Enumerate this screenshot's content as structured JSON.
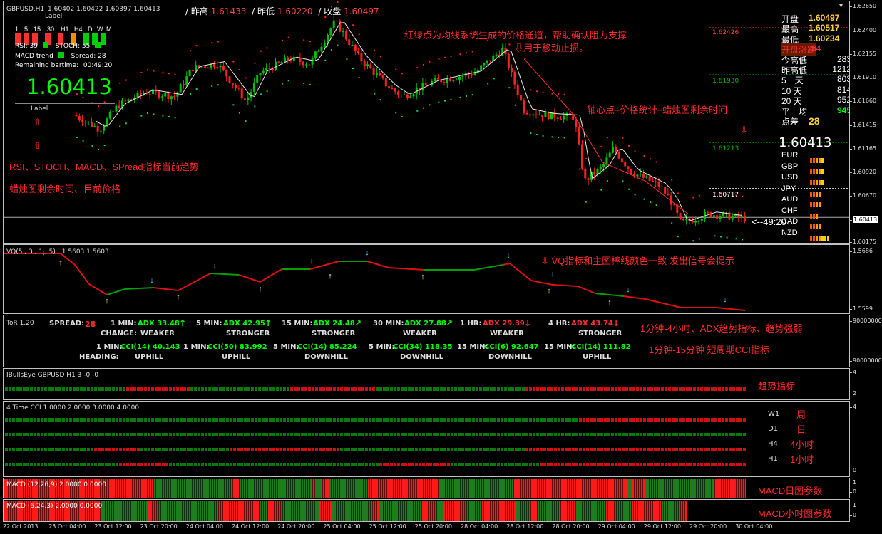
{
  "header": {
    "symbol": "GBPUSD,H1",
    "ohlc": "1.60402 1.60422 1.60397 1.60413",
    "sep": "/",
    "y_high_label": "昨高",
    "y_high": "1.61433",
    "y_low_label": "昨低",
    "y_low": "1.60220",
    "y_close_label": "收盘",
    "y_close": "1.60497"
  },
  "info": {
    "label_top": "Label",
    "timeframes": [
      "1",
      "5",
      "15",
      "30",
      "H1",
      "H4",
      "D",
      "W",
      "M"
    ],
    "tf_colors": [
      "#ff3030",
      "#ff3030",
      "#ff3030",
      "#ff3030",
      "#ff3030",
      "#ff8c00",
      "#00d000",
      "#00d000",
      "#00d000"
    ],
    "tf_colors_row2": [
      "#ff3030",
      "#ff3030",
      "#ff3030",
      "#ff3030",
      "#ff3030",
      "#ff8c00",
      "#00d000",
      "#00d000",
      "#00d000"
    ],
    "rsi": "RSI: 39",
    "stoch": "STOCH: 55",
    "macd_trend": "MACD trend",
    "spread": "Spread: 28",
    "remaining_label": "Remaining bartime:",
    "remaining": "00:49:20",
    "price": "1.60413",
    "label_bottom": "Label"
  },
  "annotations": {
    "channel_line1": "红绿点为均线系统生成的价格通道，帮助确认阻力支撑",
    "channel_line2": "⇩用于移动止损。",
    "pivot": "轴心点+价格统计+蜡烛图剩余时间",
    "arrow_down": "⇩",
    "arrow_up1": "⇧",
    "arrow_up2": "⇧",
    "indicators": "RSI、STOCH、MACD、SPread指标当前趋势",
    "candle_time": "蜡烛图剩余时间、目前价格",
    "vq": "⇩  VQ指标和主图棒线颜色一致 发出信号会提示",
    "adx": "1分钟-4小时、ADX趋势指标、趋势强弱",
    "cci": "1分钟-15分钟 短周期CCI指标",
    "trend": "趋势指标",
    "macd_d": "MACD日图参数",
    "macd_h": "MACD小时图参数"
  },
  "pivots": [
    "1.62426",
    "1.61930",
    "1.61213",
    "1.60717"
  ],
  "countdown": "<--49:20",
  "stats": [
    {
      "label": "开盘",
      "value": "1.60497",
      "color": "#ffd040"
    },
    {
      "label": "最高",
      "value": "1.60517",
      "color": "#ffd040"
    },
    {
      "label": "最低",
      "value": "1.60234",
      "color": "#ffd040"
    },
    {
      "label": "开盘涨跌",
      "value": "-84",
      "color": "#ff3030"
    },
    {
      "label": "今高低",
      "value": "283",
      "color": "#ffffff"
    },
    {
      "label": "昨高低",
      "value": "1212",
      "color": "#ffffff"
    },
    {
      "label": "5　天",
      "value": "803",
      "color": "#ffffff"
    },
    {
      "label": "10 天",
      "value": "814",
      "color": "#ffffff"
    },
    {
      "label": "20 天",
      "value": "952",
      "color": "#ffffff"
    },
    {
      "label": "平　均",
      "value": "945",
      "color": "#00ff00"
    },
    {
      "label": "点差",
      "value": "28",
      "color": "#ffd040"
    }
  ],
  "big_price": "1.60413",
  "currencies": [
    "EUR",
    "GBP",
    "USD",
    "JPY",
    "AUD",
    "CHF",
    "CAD",
    "NZD"
  ],
  "price_scale": [
    "1.62650",
    "1.62400",
    "1.62155",
    "1.61910",
    "1.61660",
    "1.61415",
    "1.61165",
    "1.60920",
    "1.60670",
    "1.60413",
    "1.60175"
  ],
  "vq": {
    "title": "VQ(5 , 3 , 1 , 5)",
    "values": "1.5603 1.5603",
    "scale": [
      "1.5686",
      "1.5599"
    ]
  },
  "tor": {
    "title": "ToR 1.20",
    "spread_label": "SPREAD:",
    "spread": "28",
    "change_label": "CHANGE:",
    "heading_label": "HEADING:",
    "adx": [
      {
        "tf": "1 MIN:",
        "val": "ADX 33.48",
        "arrow": "↑",
        "state": "WEAKER",
        "color": "#00ff00"
      },
      {
        "tf": "5 MIN:",
        "val": "ADX 42.95",
        "arrow": "↑",
        "state": "STRONGER",
        "color": "#00ff00"
      },
      {
        "tf": "15 MIN:",
        "val": "ADX 24.48",
        "arrow": "↗",
        "state": "STRONGER",
        "color": "#00ff00"
      },
      {
        "tf": "30 MIN:",
        "val": "ADX 27.88",
        "arrow": "↗",
        "state": "WEAKER",
        "color": "#00ff00"
      },
      {
        "tf": "1 HR:",
        "val": "ADX 29.39",
        "arrow": "↓",
        "state": "WEAKER",
        "color": "#ff3030"
      },
      {
        "tf": "4 HR:",
        "val": "ADX 43.74",
        "arrow": "↓",
        "state": "STRONGER",
        "color": "#ff3030"
      }
    ],
    "cci": [
      {
        "tf": "1 MIN:",
        "val": "CCI(14) 40.143",
        "state": "UPHILL"
      },
      {
        "tf": "1 MIN:",
        "val": "CCI(50) 83.992",
        "state": "UPHILL"
      },
      {
        "tf": "5 MIN:",
        "val": "CCI(14) 85.224",
        "state": "DOWNHILL"
      },
      {
        "tf": "5 MIN:",
        "val": "CCI(34) 118.35",
        "state": "DOWNHILL"
      },
      {
        "tf": "15 MIN:",
        "val": "CCI(6) 92.647",
        "state": "DOWNHILL"
      },
      {
        "tf": "15 MIN:",
        "val": "CCI(14) 111.82",
        "state": "UPHILL"
      }
    ],
    "scale": [
      "90000000",
      "90000000"
    ]
  },
  "bulls": {
    "title": "IBullsEye GBPUSD H1 3 -0 -0",
    "scale": [
      "4",
      "2"
    ]
  },
  "cci4": {
    "title": "4 Time CCI 1.0000 2.0000 3.0000 4.0000",
    "rows": [
      "W1",
      "D1",
      "H4",
      "H1"
    ],
    "cn": [
      "周",
      "日",
      "4小时",
      "1小时"
    ],
    "scale": [
      "4",
      "0"
    ]
  },
  "macd1": {
    "title": "MACD (12,26,9) 2.0000 0.0000",
    "scale": [
      "1",
      "0"
    ]
  },
  "macd2": {
    "title": "MACD (6,24,3) 2.0000 0.0000",
    "scale": [
      "1",
      "0"
    ]
  },
  "time_axis": [
    "22 Oct 2013",
    "23 Oct 04:00",
    "23 Oct 12:00",
    "23 Oct 20:00",
    "24 Oct 04:00",
    "24 Oct 12:00",
    "24 Oct 20:00",
    "25 Oct 04:00",
    "25 Oct 12:00",
    "25 Oct 20:00",
    "28 Oct 04:00",
    "28 Oct 12:00",
    "28 Oct 20:00",
    "29 Oct 04:00",
    "29 Oct 12:00",
    "29 Oct 20:00",
    "30 Oct 04:00"
  ]
}
